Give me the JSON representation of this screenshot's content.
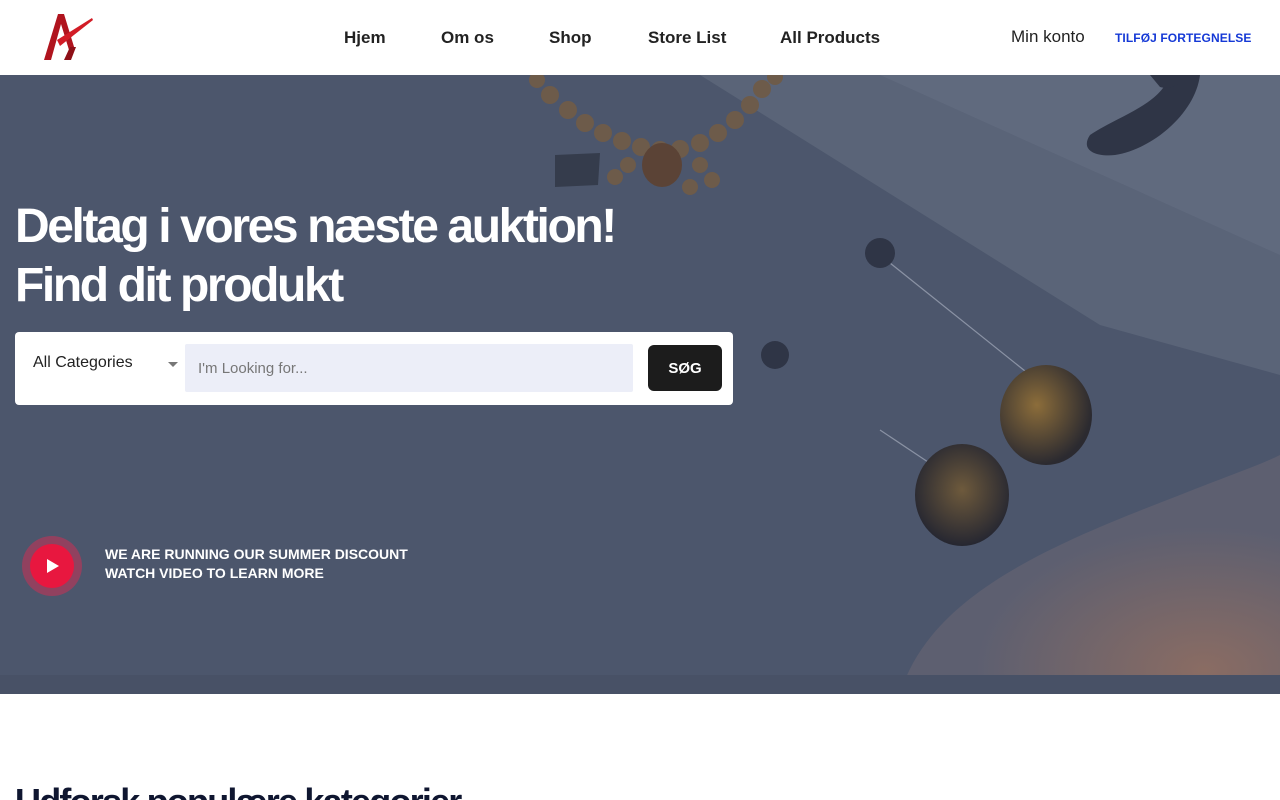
{
  "header": {
    "logo_icon": "brand-logo-icon",
    "nav": [
      {
        "label": "Hjem"
      },
      {
        "label": "Om os"
      },
      {
        "label": "Shop"
      },
      {
        "label": "Store List"
      },
      {
        "label": "All Products"
      }
    ],
    "account_label": "Min konto",
    "add_listing_label": "TILFØJ FORTEGNELSE"
  },
  "hero": {
    "title_line1": "Deltag i vores næste auktion!",
    "title_line2": "Find dit produkt",
    "search": {
      "category_selected": "All Categories",
      "placeholder": "I'm Looking for...",
      "value": "",
      "button_label": "SØG"
    },
    "promo": {
      "line1": "WE ARE RUNNING OUR SUMMER DISCOUNT",
      "line2": "WATCH VIDEO TO LEARN MORE"
    }
  },
  "sections": {
    "categories_title": "Udforsk populære kategorier"
  },
  "colors": {
    "brand_red": "#b0141e",
    "link_blue": "#1539d6",
    "play_red": "#e8173f",
    "hero_overlay": "#4c566c",
    "button_dark": "#1c1c1c"
  }
}
